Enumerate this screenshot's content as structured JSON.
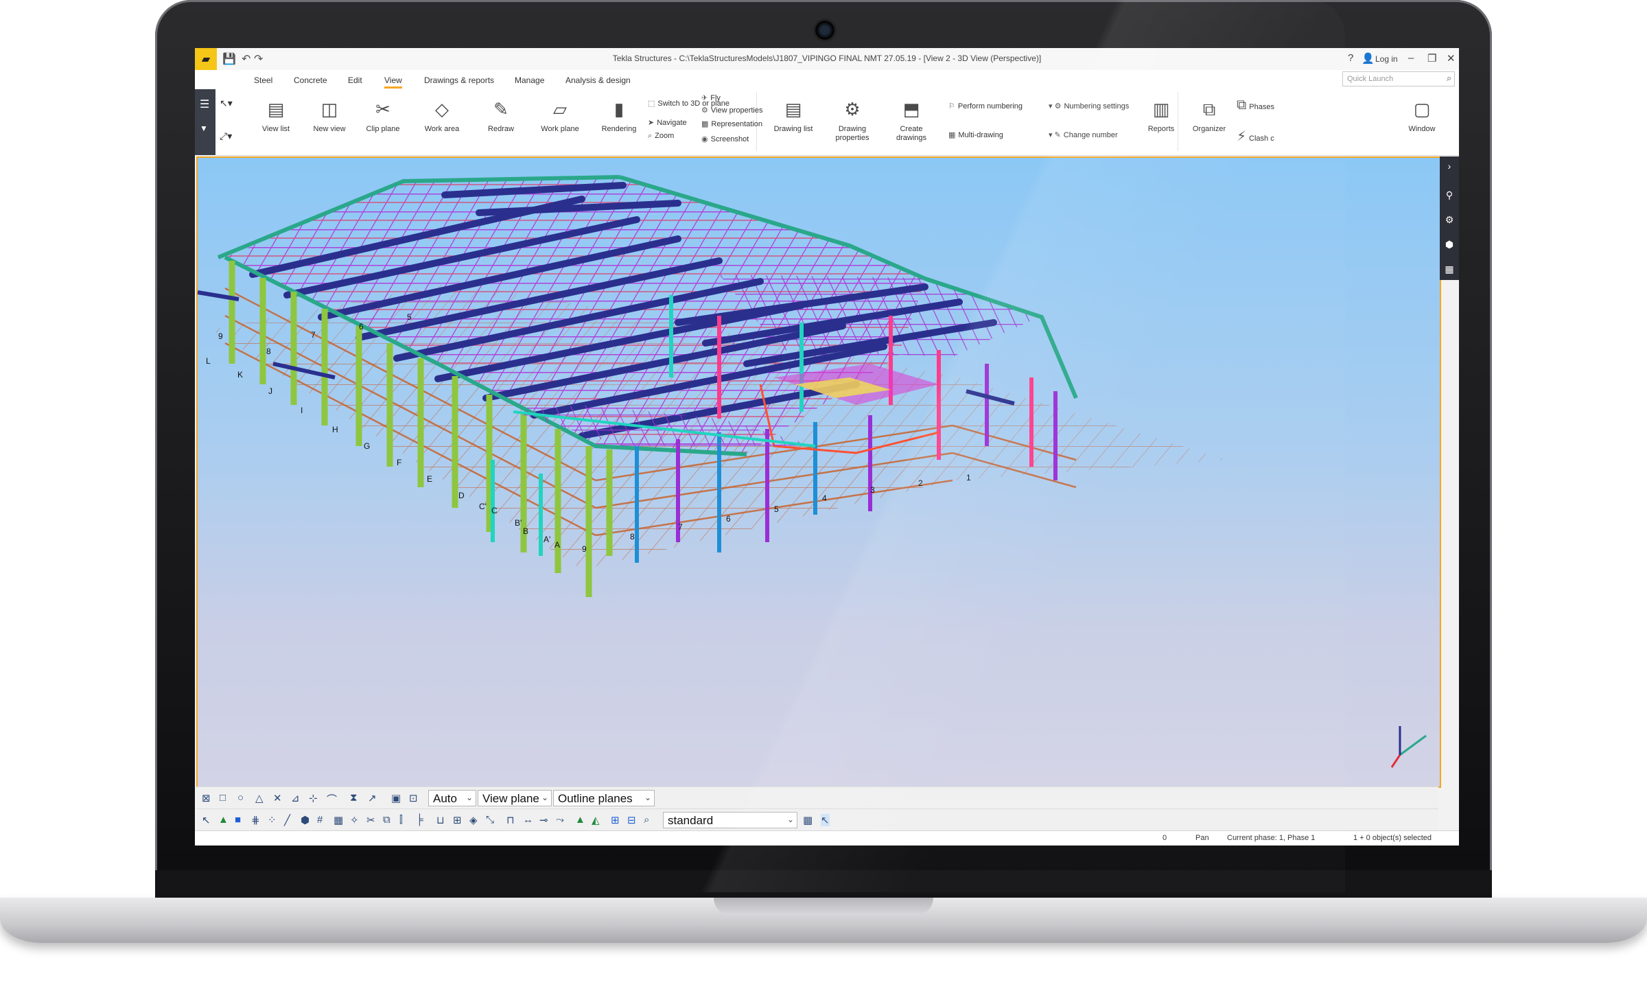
{
  "window": {
    "title": "Tekla Structures - C:\\TeklaStructuresModels\\J1807_VIPINGO FINAL NMT 27.05.19 - [View 2 - 3D View (Perspective)]",
    "help": "?",
    "login": "Log in"
  },
  "menu": {
    "items": [
      "Steel",
      "Concrete",
      "Edit",
      "View",
      "Drawings & reports",
      "Manage",
      "Analysis & design"
    ],
    "active_index": 3
  },
  "quick_launch": {
    "placeholder": "Quick Launch"
  },
  "ribbon": {
    "view_group": {
      "view_list": "View list",
      "new_view": "New view",
      "clip_plane": "Clip plane",
      "work_area": "Work area",
      "redraw": "Redraw",
      "work_plane": "Work plane",
      "rendering": "Rendering",
      "switch_3d": "Switch to 3D or plane",
      "navigate": "Navigate",
      "zoom": "Zoom",
      "fly": "Fly",
      "view_properties": "View properties",
      "representation": "Representation",
      "screenshot": "Screenshot"
    },
    "drawing_group": {
      "drawing_list": "Drawing list",
      "drawing_properties": "Drawing properties",
      "create_drawings": "Create drawings",
      "perform_numbering": "Perform numbering",
      "multi_drawing": "Multi-drawing",
      "numbering_settings": "Numbering settings",
      "change_number": "Change number",
      "reports": "Reports"
    },
    "manage_group": {
      "organizer": "Organizer",
      "phases": "Phases",
      "clash": "Clash c",
      "window": "Window"
    }
  },
  "grid_labels": {
    "left_letters": [
      "L",
      "K",
      "J",
      "I",
      "H",
      "G",
      "F",
      "E",
      "D",
      "C'",
      "C",
      "B'",
      "B",
      "A'",
      "A"
    ],
    "front_numbers": [
      "9",
      "8",
      "7",
      "6",
      "5",
      "4",
      "3",
      "2",
      "1"
    ],
    "left_numbers": [
      "9",
      "8",
      "7",
      "6",
      "5"
    ]
  },
  "toolbar": {
    "auto": "Auto",
    "view_plane": "View plane",
    "outline_planes": "Outline planes",
    "standard": "standard"
  },
  "status": {
    "count": "0",
    "mode": "Pan",
    "phase": "Current phase: 1, Phase 1",
    "selection": "1 + 0 object(s) selected"
  },
  "colors": {
    "accent": "#f5a623",
    "sky_top": "#8cc8f5",
    "roof_purple": "#9a2ed6",
    "truss_navy": "#2a2f8e",
    "column_green": "#8ec63f",
    "eave_teal": "#2aa88a",
    "purlin_orange": "#c8642e"
  },
  "icons": [
    "menu-icon",
    "save-icon",
    "undo-icon",
    "redo-icon",
    "search-icon",
    "gear-icon",
    "cube-icon",
    "axis-icon"
  ]
}
